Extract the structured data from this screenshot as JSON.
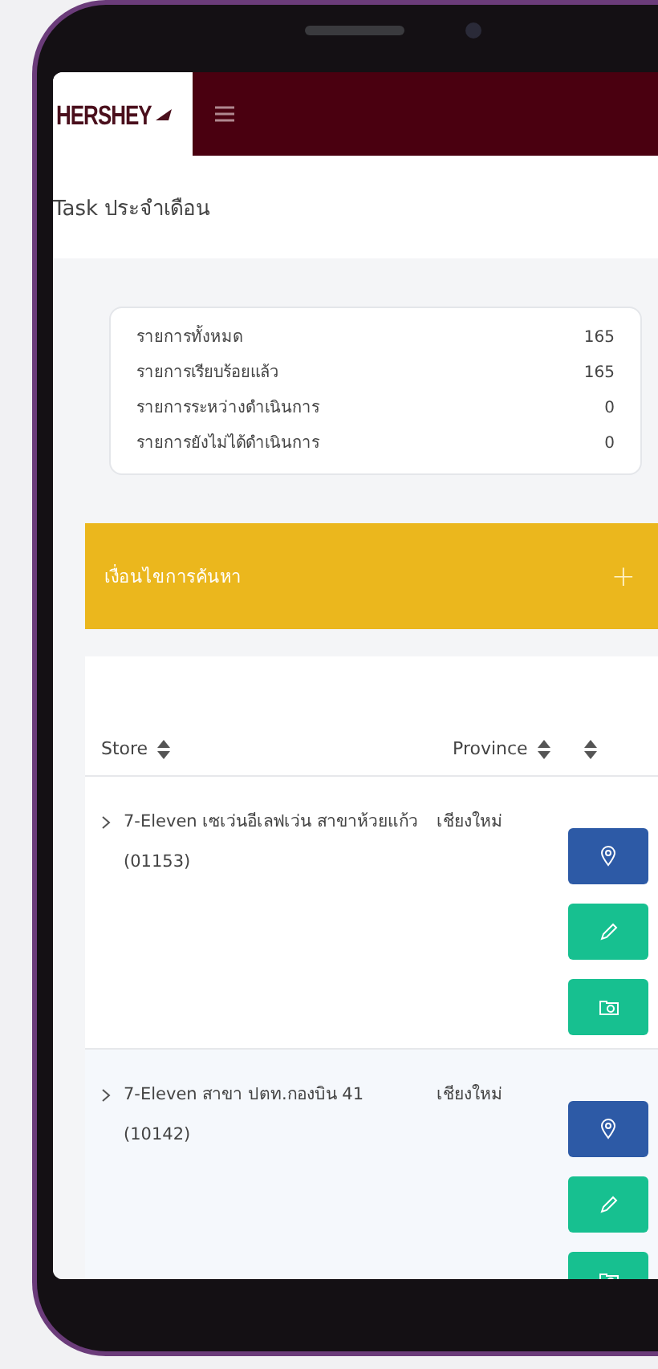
{
  "header": {
    "logo": "HERSHEY"
  },
  "page_title": "Task ประจำเดือน",
  "summary": [
    {
      "label": "รายการทั้งหมด",
      "value": "165"
    },
    {
      "label": "รายการเรียบร้อยแล้ว",
      "value": "165"
    },
    {
      "label": "รายการระหว่างดำเนินการ",
      "value": "0"
    },
    {
      "label": "รายการยังไม่ได้ดำเนินการ",
      "value": "0"
    }
  ],
  "filter": {
    "label": "เงื่อนไขการค้นหา",
    "toggle": "+"
  },
  "table": {
    "columns": [
      {
        "label": "Store",
        "sortable": true
      },
      {
        "label": "Province",
        "sortable": true
      },
      {
        "sortable": true
      }
    ],
    "rows": [
      {
        "store": "7-Eleven เซเว่นอีเลฟเว่น สาขาห้วยแก้ว (01153)",
        "province": "เชียงใหม่",
        "expanded": false
      },
      {
        "store": "7-Eleven สาขา ปตท.กองบิน 41 (10142)",
        "province": "เชียงใหม่",
        "expanded": false
      }
    ]
  }
}
